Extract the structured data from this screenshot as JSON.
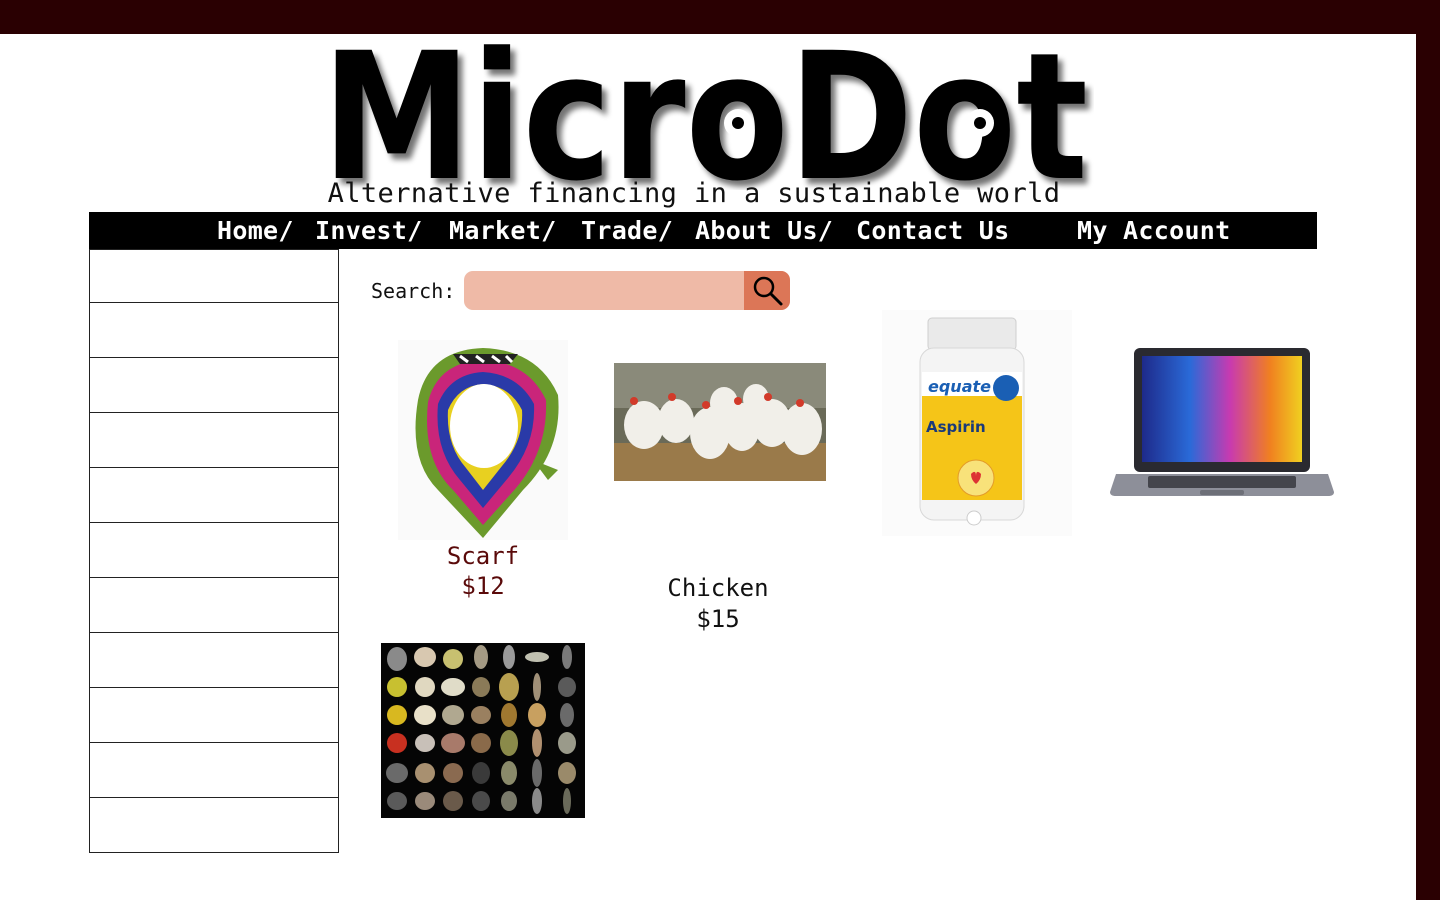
{
  "brand": {
    "name": "MicroDot",
    "tagline": "Alternative financing in a sustainable world"
  },
  "nav": {
    "items": [
      "Home/",
      "Invest/",
      "Market/",
      "Trade/",
      "About Us/",
      "Contact Us"
    ],
    "account": "My Account"
  },
  "sidebar": {
    "row_count": 11
  },
  "search": {
    "label": "Search:",
    "value": "",
    "placeholder": "",
    "icon": "search-icon"
  },
  "products": [
    {
      "name": "Scarf",
      "price": "$12",
      "image": "silk-scarf-image",
      "text_color": "#5a0a0a"
    },
    {
      "name": "Chicken",
      "price": "$15",
      "image": "chickens-image",
      "text_color": "#111111"
    },
    {
      "image": "aspirin-bottle-image",
      "bottle_brand": "equate",
      "bottle_label": "Aspirin"
    },
    {
      "image": "laptop-image"
    },
    {
      "image": "seeds-image"
    }
  ],
  "colors": {
    "frame": "#2a0002",
    "nav_bg": "#000000",
    "search_field": "#efbaa7",
    "search_button": "#dc7657",
    "scarf_text": "#5a0a0a"
  }
}
